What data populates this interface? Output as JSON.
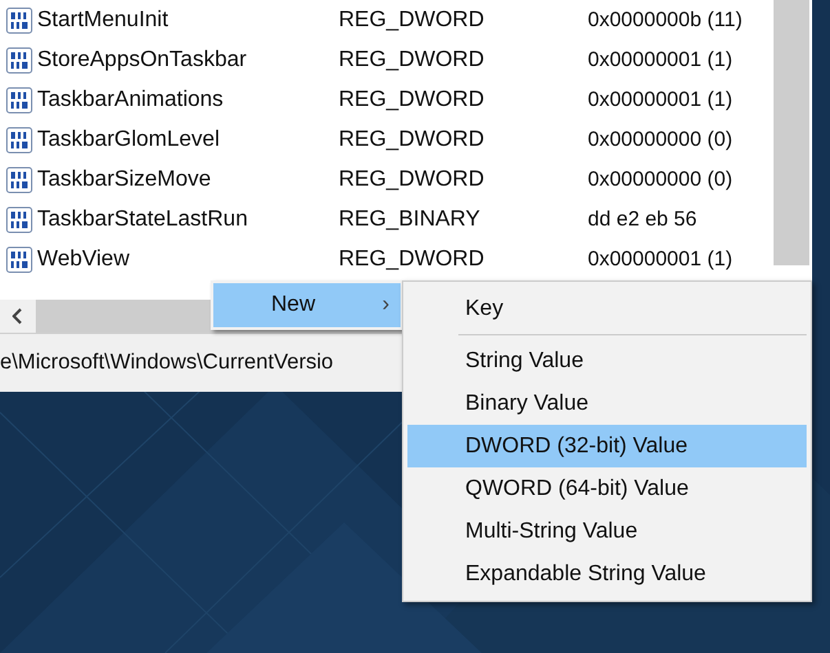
{
  "values": [
    {
      "name": "StartMenuInit",
      "type": "REG_DWORD",
      "data": "0x0000000b (11)"
    },
    {
      "name": "StoreAppsOnTaskbar",
      "type": "REG_DWORD",
      "data": "0x00000001 (1)"
    },
    {
      "name": "TaskbarAnimations",
      "type": "REG_DWORD",
      "data": "0x00000001 (1)"
    },
    {
      "name": "TaskbarGlomLevel",
      "type": "REG_DWORD",
      "data": "0x00000000 (0)"
    },
    {
      "name": "TaskbarSizeMove",
      "type": "REG_DWORD",
      "data": "0x00000000 (0)"
    },
    {
      "name": "TaskbarStateLastRun",
      "type": "REG_BINARY",
      "data": "dd e2 eb 56"
    },
    {
      "name": "WebView",
      "type": "REG_DWORD",
      "data": "0x00000001 (1)"
    }
  ],
  "address_path": "e\\Microsoft\\Windows\\CurrentVersio",
  "context_menu": {
    "label": "New",
    "arrow": "›",
    "selected": true
  },
  "submenu": [
    {
      "label": "Key",
      "selected": false,
      "separator_after": true
    },
    {
      "label": "String Value",
      "selected": false,
      "separator_after": false
    },
    {
      "label": "Binary Value",
      "selected": false,
      "separator_after": false
    },
    {
      "label": "DWORD (32-bit) Value",
      "selected": true,
      "separator_after": false
    },
    {
      "label": "QWORD (64-bit) Value",
      "selected": false,
      "separator_after": false
    },
    {
      "label": "Multi-String Value",
      "selected": false,
      "separator_after": false
    },
    {
      "label": "Expandable String Value",
      "selected": false,
      "separator_after": false
    }
  ]
}
